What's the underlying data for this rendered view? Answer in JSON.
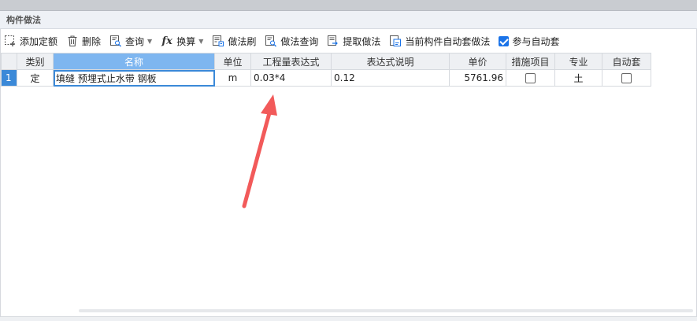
{
  "panel": {
    "title": "构件做法"
  },
  "toolbar": {
    "add_quota": "添加定额",
    "delete": "删除",
    "query": "查询",
    "convert": "换算",
    "method_brush": "做法刷",
    "method_query": "做法查询",
    "extract_method": "提取做法",
    "auto_apply_current": "当前构件自动套做法",
    "join_auto_apply": "参与自动套",
    "join_auto_apply_checked": true
  },
  "table": {
    "headers": [
      "类别",
      "名称",
      "单位",
      "工程量表达式",
      "表达式说明",
      "单价",
      "措施项目",
      "专业",
      "自动套"
    ],
    "rows": [
      {
        "index": "1",
        "category": "定",
        "name": "填缝 预埋式止水带 钢板",
        "unit": "m",
        "expression": "0.03*4",
        "explanation": "0.12",
        "price": "5761.96",
        "measure_item": false,
        "discipline": "土",
        "auto_apply": false
      }
    ]
  },
  "colors": {
    "accent": "#3b89d8",
    "header_active": "#7eb6f0",
    "annotation_arrow": "#f25a5a"
  }
}
